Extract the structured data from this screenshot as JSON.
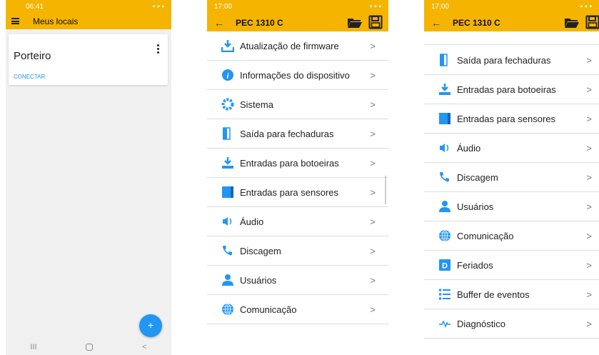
{
  "phone1": {
    "status_time": "06:41",
    "status_right": "▪ ▪ ▪",
    "appbar_title": "Meus locais",
    "card": {
      "title": "Porteiro",
      "action": "CONECTAR"
    },
    "fab_label": "+",
    "nav": {
      "recent": "III",
      "back": "<"
    }
  },
  "phone2": {
    "status_time": "17:00",
    "appbar_title": "PEC 1310 C",
    "items": [
      {
        "label": "Atualização de firmware",
        "icon": "download-icon"
      },
      {
        "label": "Informações do dispositivo",
        "icon": "info-icon"
      },
      {
        "label": "Sistema",
        "icon": "gear-icon"
      },
      {
        "label": "Saída para fechaduras",
        "icon": "door-icon"
      },
      {
        "label": "Entradas para botoeiras",
        "icon": "button-input-icon"
      },
      {
        "label": "Entradas para sensores",
        "icon": "sensor-icon"
      },
      {
        "label": "Áudio",
        "icon": "speaker-icon"
      },
      {
        "label": "Discagem",
        "icon": "phone-icon"
      },
      {
        "label": "Usuários",
        "icon": "user-icon"
      },
      {
        "label": "Comunicação",
        "icon": "globe-icon"
      }
    ]
  },
  "phone3": {
    "status_time": "17:00",
    "appbar_title": "PEC 1310 C",
    "items": [
      {
        "label": "Saída para fechaduras",
        "icon": "door-icon"
      },
      {
        "label": "Entradas para botoeiras",
        "icon": "button-input-icon"
      },
      {
        "label": "Entradas para sensores",
        "icon": "sensor-icon"
      },
      {
        "label": "Áudio",
        "icon": "speaker-icon"
      },
      {
        "label": "Discagem",
        "icon": "phone-icon"
      },
      {
        "label": "Usuários",
        "icon": "user-icon"
      },
      {
        "label": "Comunicação",
        "icon": "globe-icon"
      },
      {
        "label": "Feriados",
        "icon": "holiday-icon"
      },
      {
        "label": "Buffer de eventos",
        "icon": "list-icon"
      },
      {
        "label": "Diagnóstico",
        "icon": "pulse-icon"
      }
    ]
  },
  "chevron": ">",
  "colors": {
    "accent": "#f4b400",
    "icon_blue": "#2196f3",
    "link_blue": "#2196f3"
  }
}
